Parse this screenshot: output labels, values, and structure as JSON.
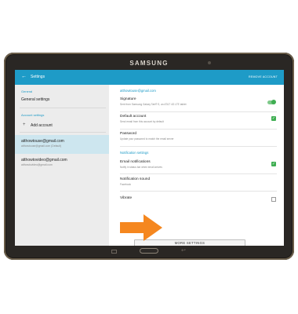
{
  "device": {
    "brand": "SAMSUNG"
  },
  "actionbar": {
    "back_glyph": "←",
    "title": "Settings",
    "action": "REMOVE ACCOUNT"
  },
  "left": {
    "general_header": "General",
    "general_settings": "General settings",
    "account_header": "Account settings",
    "add_account": "Add account",
    "accounts": [
      {
        "email": "atthowtouse@gmail.com",
        "sub": "atthowtouse@gmail.com (Default)"
      },
      {
        "email": "atthowtovideo@gmail.com",
        "sub": "atthowtovideo@gmail.com"
      }
    ]
  },
  "right": {
    "account_email": "atthowtouse@gmail.com",
    "signature_title": "Signature",
    "signature_sub": "Sent from Samsung Galaxy Tab® S, an AT&T 4G LTE tablet",
    "default_title": "Default account",
    "default_sub": "Send email from this account by default",
    "password_title": "Password",
    "password_sub": "Update your password to match the email server",
    "notif_header": "Notification settings",
    "email_notif_title": "Email notifications",
    "email_notif_sub": "Notify in status bar when email arrives",
    "sound_title": "Notification sound",
    "sound_sub": "Facebook",
    "vibrate_title": "Vibrate",
    "more_settings": "MORE SETTINGS",
    "check_glyph": "✓"
  },
  "colors": {
    "accent": "#1e9bc7",
    "arrow": "#f5871f",
    "toggle": "#3fae52"
  }
}
